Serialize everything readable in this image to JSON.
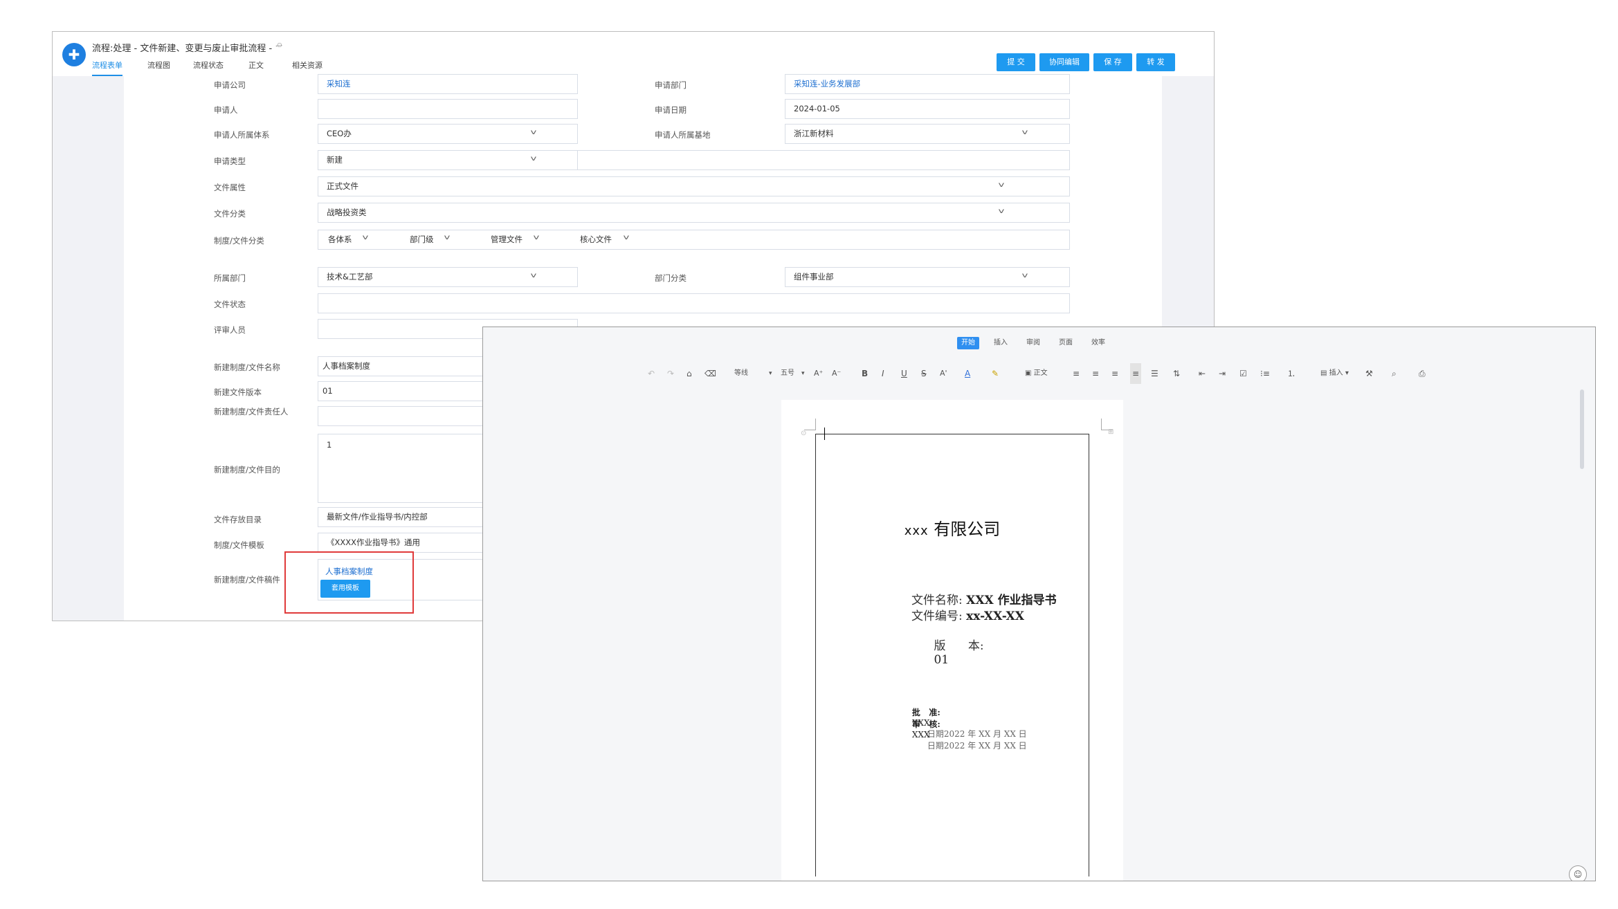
{
  "workflow": {
    "title": "流程:处理 - 文件新建、变更与废止审批流程 -",
    "tag_icon": "tag-icon",
    "tabs": [
      "流程表单",
      "流程图",
      "流程状态",
      "正文",
      "相关资源"
    ],
    "active_tab": "流程表单",
    "buttons": {
      "submit": "提 交",
      "collab": "协同编辑",
      "save": "保 存",
      "forward": "转 发"
    },
    "form": {
      "company_label": "申请公司",
      "company_value": "采知连",
      "dept_label": "申请部门",
      "dept_value": "采知连-业务发展部",
      "applicant_label": "申请人",
      "applicant_value": "",
      "date_label": "申请日期",
      "date_value": "2024-01-05",
      "system_label": "申请人所属体系",
      "system_value": "CEO办",
      "base_label": "申请人所属基地",
      "base_value": "浙江新材料",
      "type_label": "申请类型",
      "type_value": "新建",
      "attr_label": "文件属性",
      "attr_value": "正式文件",
      "category_label": "文件分类",
      "category_value": "战略投资类",
      "classify_label": "制度/文件分类",
      "classify_values": [
        "各体系",
        "部门级",
        "管理文件",
        "核心文件"
      ],
      "owner_dept_label": "所属部门",
      "owner_dept_value": "技术&工艺部",
      "dept_class_label": "部门分类",
      "dept_class_value": "组件事业部",
      "status_label": "文件状态",
      "status_value": "",
      "reviewer_label": "评审人员",
      "name_label": "新建制度/文件名称",
      "name_value": "人事档案制度",
      "version_label": "新建文件版本",
      "version_value": "01",
      "responsible_label": "新建制度/文件责任人",
      "responsible_value": "",
      "purpose_label": "新建制度/文件目的",
      "purpose_value": "1",
      "dir_label": "文件存放目录",
      "dir_value": "最新文件/作业指导书/内控部",
      "template_label": "制度/文件模板",
      "template_value": "《XXXX作业指导书》通用",
      "draft_label": "新建制度/文件稿件",
      "draft_link": "人事档案制度",
      "draft_button": "套用模板"
    }
  },
  "editor": {
    "menus": [
      "开始",
      "插入",
      "审阅",
      "页面",
      "效率"
    ],
    "active_menu": "开始",
    "toolbar": {
      "style": "等线",
      "size": "五号",
      "paragraph": "正文",
      "insert": "插入"
    },
    "document": {
      "company_prefix": "xxx",
      "company_suffix": "有限公司",
      "file_name_label": "文件名称:",
      "file_name_value": "XXX 作业指导书",
      "file_no_label": "文件编号:",
      "file_no_value": "xx-XX-XX",
      "version_label": "版      本:",
      "version_value": "01",
      "approve_label": "批   准:",
      "approve_value": "XXX",
      "approve_date": "日期2022 年 XX 月 XX 日",
      "review_label": "审   核:",
      "review_value": "XXX",
      "review_date": "日期2022 年 XX 月 XX 日"
    }
  },
  "colors": {
    "accent": "#1e9af0",
    "highlight_box": "#e03a3a",
    "link": "#1e6fd0"
  }
}
